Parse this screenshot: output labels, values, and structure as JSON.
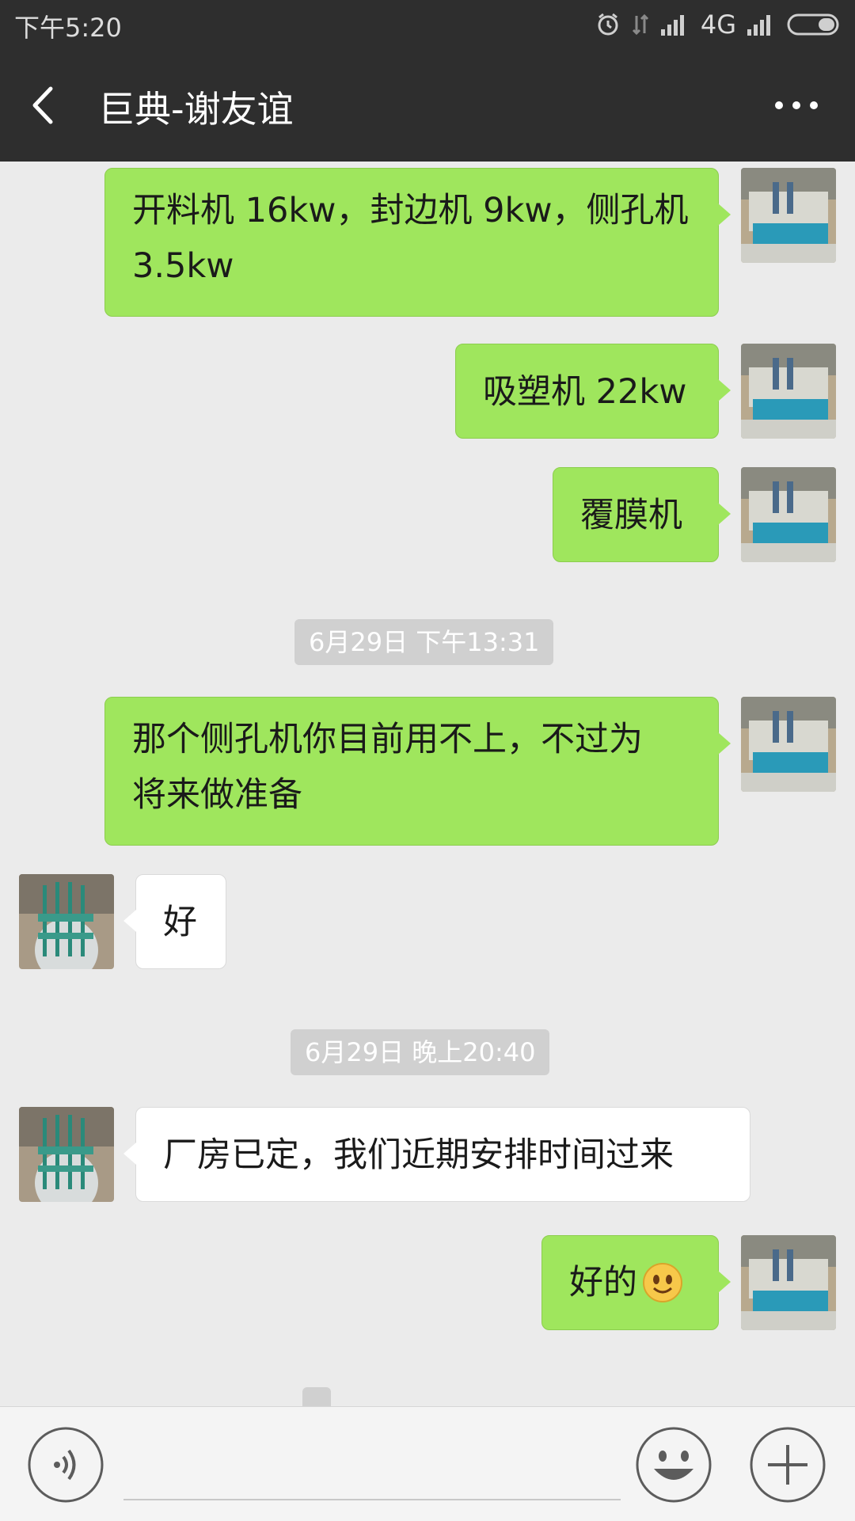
{
  "status_bar": {
    "time": "下午5:20",
    "network": "4G"
  },
  "header": {
    "title": "巨典-谢友谊",
    "back_icon": "chevron-left-icon",
    "more_icon": "more-dots-icon"
  },
  "messages": [
    {
      "from": "me",
      "text_lines": [
        "开料机 16kw，封边机 9kw，侧孔机",
        "3.5kw"
      ]
    },
    {
      "from": "me",
      "text": "吸塑机 22kw"
    },
    {
      "from": "me",
      "text": "覆膜机"
    },
    {
      "type": "timestamp",
      "text": "6月29日 下午13:31"
    },
    {
      "from": "me",
      "text_lines": [
        "那个侧孔机你目前用不上，不过为",
        "将来做准备"
      ]
    },
    {
      "from": "them",
      "text": "好"
    },
    {
      "type": "timestamp",
      "text": "6月29日 晚上20:40"
    },
    {
      "from": "them",
      "text": "厂房已定，我们近期安排时间过来"
    },
    {
      "from": "me",
      "text": "好的"
    }
  ],
  "input_bar": {
    "voice_icon": "voice-icon",
    "emoji_icon": "emoji-icon",
    "plus_icon": "plus-icon",
    "placeholder": ""
  },
  "colors": {
    "header_bg": "#2e2e2e",
    "chat_bg": "#ebebeb",
    "my_bubble": "#9fe65d",
    "their_bubble": "#ffffff"
  }
}
